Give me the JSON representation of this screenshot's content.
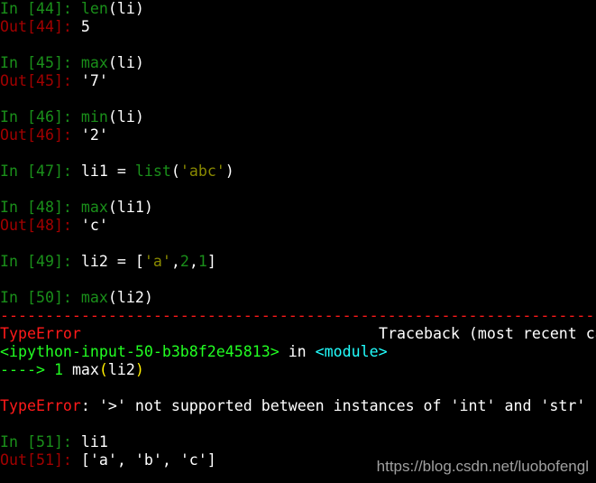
{
  "colors": {
    "background": "#000000",
    "in_prompt": "#1a8f1a",
    "out_prompt": "#a00000",
    "error_red": "#ff1a1a",
    "bright_green": "#22ff22",
    "cyan": "#22ffff",
    "string_olive": "#8a8a00",
    "paren_yellow": "#ffee00",
    "text": "#ffffff"
  },
  "cells": {
    "c44": {
      "in": "In [44]: ",
      "fn": "len",
      "code": "(li)",
      "out": "Out[44]: ",
      "result": "5"
    },
    "c45": {
      "in": "In [45]: ",
      "fn": "max",
      "code": "(li)",
      "out": "Out[45]: ",
      "result": "'7'"
    },
    "c46": {
      "in": "In [46]: ",
      "fn": "min",
      "code": "(li)",
      "out": "Out[46]: ",
      "result": "'2'"
    },
    "c47": {
      "in": "In [47]: ",
      "code_a": "li1 = ",
      "fn": "list",
      "paren_open": "(",
      "str": "'abc'",
      "paren_close": ")"
    },
    "c48": {
      "in": "In [48]: ",
      "fn": "max",
      "code": "(li1)",
      "out": "Out[48]: ",
      "result": "'c'"
    },
    "c49": {
      "in": "In [49]: ",
      "code_a": "li2 = [",
      "str": "'a'",
      "sep1": ",",
      "n1": "2",
      "sep2": ",",
      "n2": "1",
      "close": "]"
    },
    "c50": {
      "in": "In [50]: ",
      "fn": "max",
      "code": "(li2)"
    },
    "c51": {
      "in": "In [51]: ",
      "code": "li1",
      "out": "Out[51]: ",
      "result": "['a', 'b', 'c']"
    }
  },
  "traceback": {
    "separator": "---------------------------------------------------------------------------",
    "error_name": "TypeError",
    "header_right": "Traceback (most recent call last)",
    "location_file": "<ipython-input-50-b3b8f2e45813>",
    "location_in": " in ",
    "location_module": "<module>",
    "arrow": "----> 1 ",
    "line_fn": "max",
    "line_paren_open": "(",
    "line_arg": "li2",
    "line_paren_close": ")",
    "message_name": "TypeError",
    "message_colon": ": ",
    "message_text": "'>' not supported between instances of 'int' and 'str'"
  },
  "watermark": "https://blog.csdn.net/luobofengl"
}
